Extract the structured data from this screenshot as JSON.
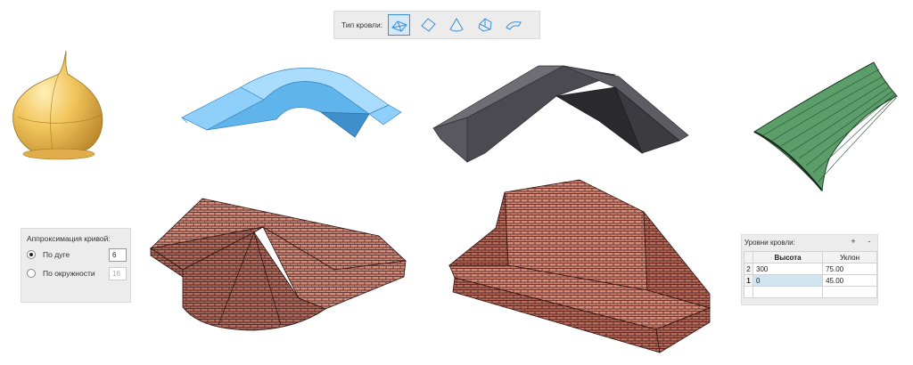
{
  "toolbar": {
    "label": "Тип кровли:",
    "buttons": [
      {
        "icon": "hip-roof-icon",
        "active": true
      },
      {
        "icon": "diamond-roof-icon",
        "active": false
      },
      {
        "icon": "cone-roof-icon",
        "active": false
      },
      {
        "icon": "faceted-roof-icon",
        "active": false
      },
      {
        "icon": "curved-roof-icon",
        "active": false
      }
    ]
  },
  "approx": {
    "title": "Аппроксимация кривой:",
    "options": [
      {
        "label": "По дуге",
        "value": "6",
        "selected": true
      },
      {
        "label": "По окружности",
        "value": "16",
        "selected": false
      }
    ]
  },
  "levels": {
    "title": "Уровни кровли:",
    "add": "+",
    "remove": "-",
    "headers": [
      "Высота",
      "Уклон"
    ],
    "rows": [
      {
        "idx": "2",
        "height": "300",
        "slope": "75.00"
      },
      {
        "idx": "1",
        "height": "0",
        "slope": "45.00"
      }
    ]
  },
  "colors": {
    "dome": "#f2c55c",
    "blue_roof": "#7cc4f4",
    "gray_roof": "#4c4c50",
    "green_roof": "#5c9e6a",
    "tile": "#d98b7c",
    "accent": "#3b8fd6"
  }
}
